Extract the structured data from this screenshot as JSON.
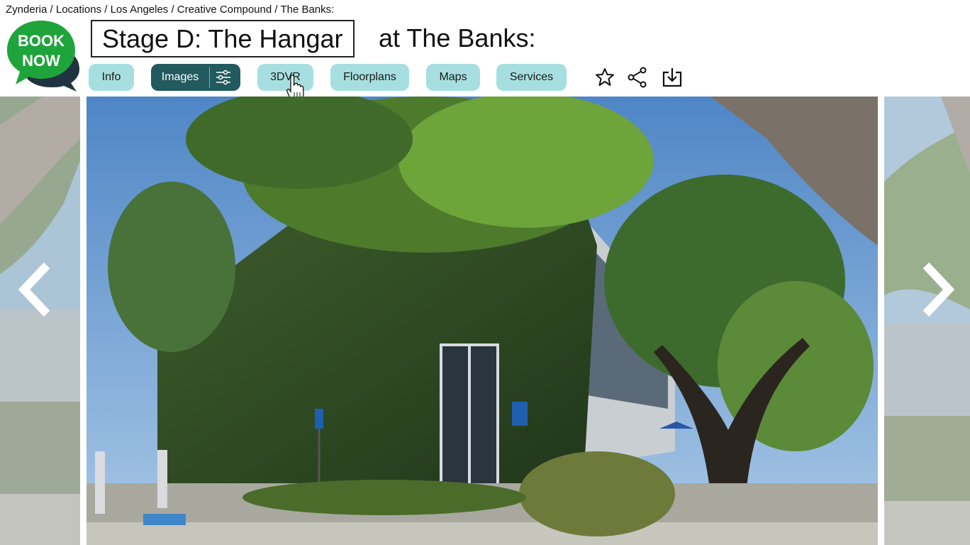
{
  "breadcrumb": "Zynderia / Locations / Los Angeles / Creative Compound / The Banks:",
  "logo": {
    "line1": "BOOK",
    "line2": "NOW",
    "color": "#1fa43c"
  },
  "title": {
    "boxed": "Stage D: The Hangar",
    "rest": "at The Banks:"
  },
  "tabs": {
    "info": "Info",
    "images": "Images",
    "vr": "3DVR",
    "floorplans": "Floorplans",
    "maps": "Maps",
    "services": "Services"
  },
  "active_tab": "Images",
  "colors": {
    "tab_bg": "#a7dfe0",
    "tab_active_bg": "#215a5f"
  },
  "icons": [
    "filter-settings-icon",
    "star-icon",
    "share-icon",
    "download-icon",
    "expand-icon",
    "chevron-left-icon",
    "chevron-right-icon",
    "hand-cursor-icon"
  ]
}
